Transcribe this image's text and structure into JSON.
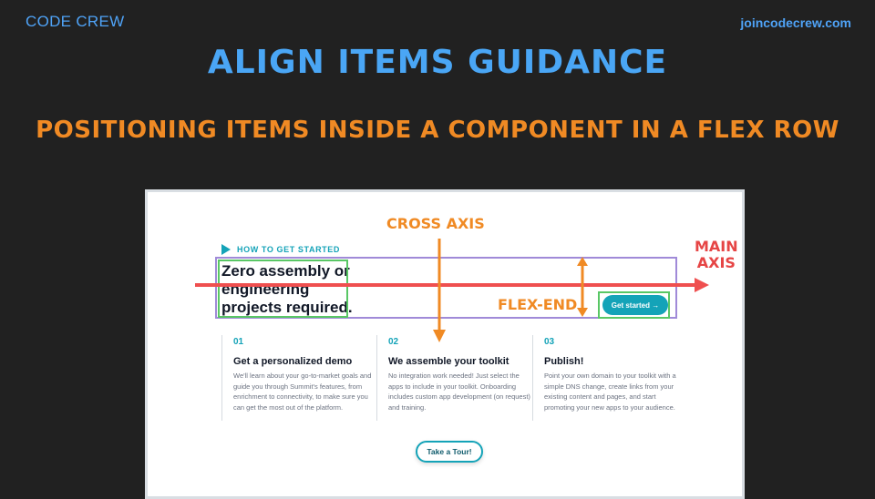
{
  "header": {
    "brand": "CODE CREW",
    "site": "joincodecrew.com"
  },
  "slide": {
    "title": "ALIGN ITEMS GUIDANCE",
    "subtitle": "POSITIONING ITEMS INSIDE A COMPONENT IN A FLEX ROW"
  },
  "screenshot": {
    "eyebrow": "HOW TO GET STARTED",
    "headline": "Zero assembly or engineering projects required.",
    "cta_label": "Get started →",
    "steps": [
      {
        "num": "01",
        "title": "Get a personalized demo",
        "body": "We'll learn about your go-to-market goals and guide you through Summit's features, from enrichment to connectivity, to make sure you can get the most out of the platform."
      },
      {
        "num": "02",
        "title": "We assemble your toolkit",
        "body": "No integration work needed! Just select the apps to include in your toolkit. Onboarding includes custom app development (on request) and training."
      },
      {
        "num": "03",
        "title": "Publish!",
        "body": "Point your own domain to your toolkit with a simple DNS change, create links from your existing content and pages, and start promoting your new apps to your audience."
      }
    ],
    "tour_label": "Take a Tour!"
  },
  "annotations": {
    "cross_axis": "CROSS AXIS",
    "main_axis_line1": "MAIN",
    "main_axis_line2": "AXIS",
    "flex_end": "FLEX-END",
    "colors": {
      "main_axis": "#ef4f4f",
      "cross_axis": "#f08a24",
      "container": "#a08ad8",
      "item": "#59c765"
    }
  },
  "icons": {
    "eyebrow": "play-icon"
  }
}
